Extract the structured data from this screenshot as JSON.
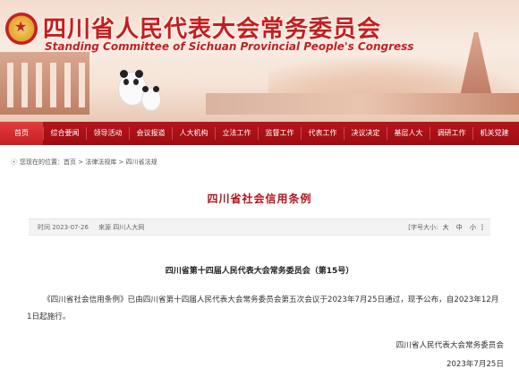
{
  "header": {
    "title_cn": "四川省人民代表大会常务委员会",
    "title_en": "Standing Committee of Sichuan Provincial People's Congress",
    "emblem_icon": "national-emblem-icon",
    "brand_color": "#c51d1d"
  },
  "nav": {
    "items": [
      {
        "label": "首页"
      },
      {
        "label": "综合要闻"
      },
      {
        "label": "领导活动"
      },
      {
        "label": "会议报道"
      },
      {
        "label": "人大机构"
      },
      {
        "label": "立法工作"
      },
      {
        "label": "监督工作"
      },
      {
        "label": "代表工作"
      },
      {
        "label": "决议决定"
      },
      {
        "label": "基层人大"
      },
      {
        "label": "调研工作"
      },
      {
        "label": "机关党建"
      }
    ],
    "bg_color": "#a80f15"
  },
  "breadcrumb": {
    "prefix": "您现在的位置：",
    "trail": "首页 > 法律法规库 > 四川省法规"
  },
  "article": {
    "title": "四川省社会信用条例",
    "time_label": "时间 2023-07-26",
    "source_label": "来源 四川人大网",
    "font_size_label": "[字号大小:",
    "font_sizes": [
      "大",
      "中",
      "小"
    ],
    "font_size_close": "]",
    "announcement": "四川省第十四届人民代表大会常务委员会（第15号）",
    "body": "《四川省社会信用条例》已由四川省第十四届人民代表大会常务委员会第五次会议于2023年7月25日通过，现予公布，自2023年12月1日起施行。",
    "signature": "四川省人民代表大会常务委员会",
    "date": "2023年7月25日"
  }
}
